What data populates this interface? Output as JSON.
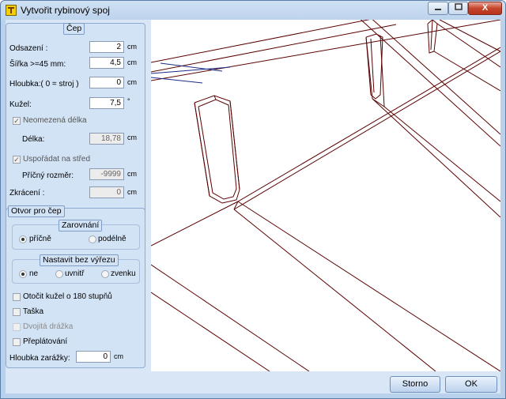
{
  "window": {
    "title": "Vytvořit rybinový spoj",
    "close_glyph": "X",
    "minimize_icon": "minimize-icon",
    "maximize_icon": "maximize-icon"
  },
  "cep": {
    "legend": "Čep",
    "odsazeni": {
      "label": "Odsazení :",
      "value": "2",
      "unit": "cm"
    },
    "sirka": {
      "label": "Šířka >=45 mm:",
      "value": "4,5",
      "unit": "cm"
    },
    "hloubka": {
      "label": "Hloubka:( 0 = stroj )",
      "value": "0",
      "unit": "cm"
    },
    "kuzel": {
      "label": "Kužel:",
      "value": "7,5",
      "unit": "°"
    },
    "neomezena": {
      "label": "Neomezená délka",
      "checked": true
    },
    "delka": {
      "label": "Délka:",
      "value": "18,78",
      "unit": "cm"
    },
    "usporadat": {
      "label": "Uspořádat na střed",
      "checked": true
    },
    "pricny": {
      "label": "Příčný rozměr:",
      "value": "-9999",
      "unit": "cm"
    },
    "zkraceni": {
      "label": "Zkrácení  :",
      "value": "0",
      "unit": "cm"
    }
  },
  "otvor": {
    "legend": "Otvor pro čep",
    "zarovnani": {
      "legend": "Zarovnání",
      "options": [
        "příčně",
        "podélně"
      ],
      "selected": "příčně"
    },
    "nastavit": {
      "legend": "Nastavit bez výřezu",
      "options": [
        "ne",
        "uvnitř",
        "zvenku"
      ],
      "selected": "ne"
    },
    "otocit": "Otočit kužel o 180 stupňů",
    "taska": "Taška",
    "dvojita": "Dvojitá drážka",
    "preplatovani": "Přeplátování",
    "hloubka_zarazky": {
      "label": "Hloubka zarážky:",
      "value": "0",
      "unit": "cm"
    }
  },
  "buttons": {
    "storno": "Storno",
    "ok": "OK"
  },
  "colors": {
    "model_lines": "#5a0000",
    "axis_lines": "#1a2a8a",
    "accent": "#b9d1ec"
  }
}
